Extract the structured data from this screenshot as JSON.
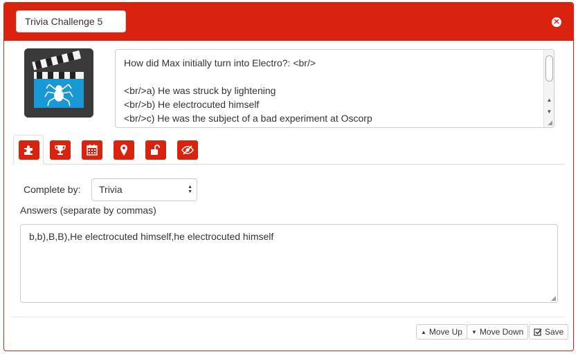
{
  "header": {
    "title_value": "Trivia Challenge 5",
    "close_icon": "close-circle-icon",
    "accent": "#d9230f"
  },
  "question": {
    "text": "How did Max initially turn into Electro?: <br/>\n\n<br/>a) He was struck by lightening\n<br/>b) He electrocuted himself\n<br/>c) He was the subject of a bad experiment at Oscorp\n<br/>d) He fell into a vat of eels"
  },
  "tabs": [
    {
      "icon": "puzzle-icon",
      "active": true
    },
    {
      "icon": "trophy-icon"
    },
    {
      "icon": "calendar-icon"
    },
    {
      "icon": "map-marker-icon"
    },
    {
      "icon": "unlock-icon"
    },
    {
      "icon": "eye-slash-icon"
    }
  ],
  "form": {
    "complete_by_label": "Complete by:",
    "complete_by_value": "Trivia",
    "answers_label": "Answers (separate by commas)",
    "answers_value": "b,b),B,B),He electrocuted himself,he electrocuted himself"
  },
  "footer": {
    "move_up_label": "Move Up",
    "move_down_label": "Move Down",
    "save_label": "Save"
  }
}
